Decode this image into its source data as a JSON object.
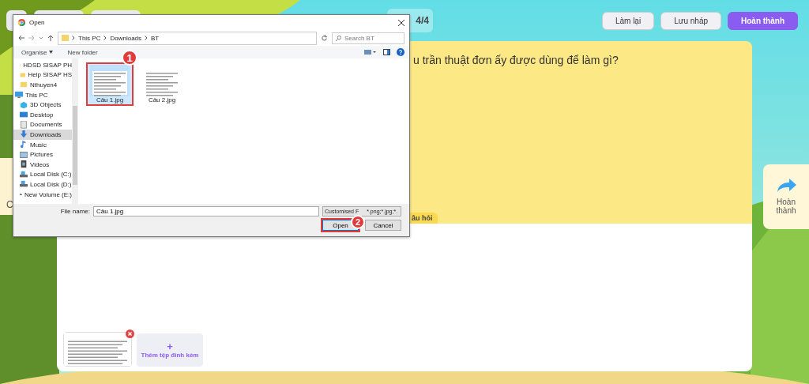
{
  "header": {
    "progress": "4/4",
    "buttons": [
      {
        "label": "Làm lại",
        "kind": "secondary"
      },
      {
        "label": "Lưu nháp",
        "kind": "secondary"
      },
      {
        "label": "Hoàn thành",
        "kind": "primary"
      }
    ]
  },
  "left_edge_text": "C",
  "question": {
    "text": "u trần thuật đơn ấy được dùng để làm gì?",
    "tab": "âu hỏi"
  },
  "answer": {
    "add_button": {
      "icon": "+",
      "label": "Thêm tệp đính kèm"
    }
  },
  "side_button": {
    "label": "Hoàn thành"
  },
  "dialog": {
    "title": "Open",
    "breadcrumb": [
      "This PC",
      "Downloads",
      "BT"
    ],
    "search_placeholder": "Search BT",
    "organise": "Organise",
    "new_folder": "New folder",
    "nav_items": [
      {
        "label": "HDSD SISAP PH",
        "kind": "folder",
        "selected": false
      },
      {
        "label": "Help SISAP HS",
        "kind": "folder",
        "selected": false
      },
      {
        "label": "Nthuyen4",
        "kind": "folder",
        "selected": false
      },
      {
        "label": "This PC",
        "kind": "pc",
        "selected": false
      },
      {
        "label": "3D Objects",
        "kind": "objects",
        "selected": false
      },
      {
        "label": "Desktop",
        "kind": "desktop",
        "selected": false
      },
      {
        "label": "Documents",
        "kind": "documents",
        "selected": false
      },
      {
        "label": "Downloads",
        "kind": "downloads",
        "selected": true
      },
      {
        "label": "Music",
        "kind": "music",
        "selected": false
      },
      {
        "label": "Pictures",
        "kind": "pictures",
        "selected": false
      },
      {
        "label": "Videos",
        "kind": "videos",
        "selected": false
      },
      {
        "label": "Local Disk (C:)",
        "kind": "disk",
        "selected": false
      },
      {
        "label": "Local Disk (D:)",
        "kind": "disk",
        "selected": false
      },
      {
        "label": "New Volume (E:)",
        "kind": "disk",
        "selected": false
      }
    ],
    "files": [
      {
        "name": "Câu 1.jpg",
        "selected": true,
        "highlighted": true
      },
      {
        "name": "Câu 2.jpg",
        "selected": false,
        "highlighted": false
      }
    ],
    "file_name_label": "File name:",
    "file_name": "Câu 1.jpg",
    "filter": {
      "before": "Customised F",
      "after": "*.png;*.jpg;*."
    },
    "buttons": [
      {
        "label": "Open",
        "highlighted": true
      },
      {
        "label": "Cancel",
        "highlighted": false
      }
    ]
  },
  "annotations": [
    {
      "number": "1"
    },
    {
      "number": "2"
    }
  ]
}
